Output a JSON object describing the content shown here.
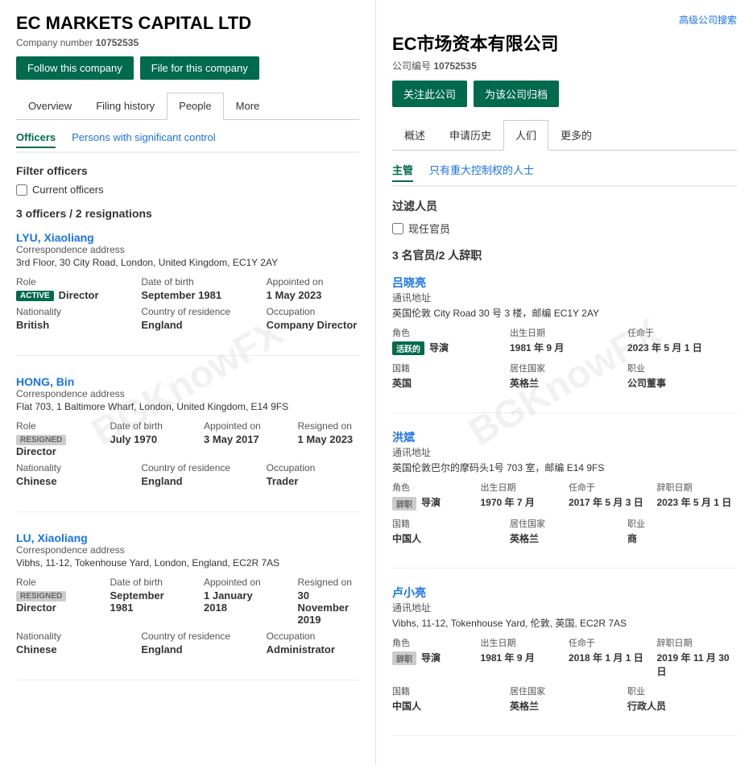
{
  "left": {
    "company_title": "EC MARKETS CAPITAL LTD",
    "company_number_label": "Company number",
    "company_number": "10752535",
    "btn_follow": "Follow this company",
    "btn_file": "File for this company",
    "tabs": [
      {
        "label": "Overview",
        "active": false
      },
      {
        "label": "Filing history",
        "active": false
      },
      {
        "label": "People",
        "active": true
      },
      {
        "label": "More",
        "active": false
      }
    ],
    "sub_tabs": [
      {
        "label": "Officers",
        "active": true
      },
      {
        "label": "Persons with significant control",
        "active": false
      }
    ],
    "filter_title": "Filter officers",
    "current_officers_label": "Current officers",
    "officer_count": "3 officers / 2 resignations",
    "watermark": "BGKnowFX",
    "officers": [
      {
        "name": "LYU, Xiaoliang",
        "address_label": "Correspondence address",
        "address": "3rd Floor, 30 City Road, London, United Kingdom, EC1Y 2AY",
        "role_label": "Role",
        "role": "Director",
        "role_status": "ACTIVE",
        "role_status_type": "active",
        "dob_label": "Date of birth",
        "dob": "September 1981",
        "appointed_label": "Appointed on",
        "appointed": "1 May 2023",
        "nationality_label": "Nationality",
        "nationality": "British",
        "residence_label": "Country of residence",
        "residence": "England",
        "occupation_label": "Occupation",
        "occupation": "Company Director"
      },
      {
        "name": "HONG, Bin",
        "address_label": "Correspondence address",
        "address": "Flat 703, 1 Baltimore Wharf, London, United Kingdom, E14 9FS",
        "role_label": "Role",
        "role": "Director",
        "role_status": "RESIGNED",
        "role_status_type": "resigned",
        "dob_label": "Date of birth",
        "dob": "July 1970",
        "appointed_label": "Appointed on",
        "appointed": "3 May 2017",
        "resigned_label": "Resigned on",
        "resigned": "1 May 2023",
        "nationality_label": "Nationality",
        "nationality": "Chinese",
        "residence_label": "Country of residence",
        "residence": "England",
        "occupation_label": "Occupation",
        "occupation": "Trader"
      },
      {
        "name": "LU, Xiaoliang",
        "address_label": "Correspondence address",
        "address": "Vibhs, 11-12, Tokenhouse Yard, London, England, EC2R 7AS",
        "role_label": "Role",
        "role": "Director",
        "role_status": "RESIGNED",
        "role_status_type": "resigned",
        "dob_label": "Date of birth",
        "dob": "September 1981",
        "appointed_label": "Appointed on",
        "appointed": "1 January 2018",
        "resigned_label": "Resigned on",
        "resigned": "30 November 2019",
        "nationality_label": "Nationality",
        "nationality": "Chinese",
        "residence_label": "Country of residence",
        "residence": "England",
        "occupation_label": "Occupation",
        "occupation": "Administrator"
      }
    ]
  },
  "right": {
    "advanced_search": "高级公司搜索",
    "company_title": "EC市场资本有限公司",
    "company_number_label": "公司编号",
    "company_number": "10752535",
    "btn_follow": "关注此公司",
    "btn_file": "为该公司归档",
    "tabs": [
      {
        "label": "概述",
        "active": false
      },
      {
        "label": "申请历史",
        "active": false
      },
      {
        "label": "人们",
        "active": true
      },
      {
        "label": "更多的",
        "active": false
      }
    ],
    "sub_tabs": [
      {
        "label": "主管",
        "active": true
      },
      {
        "label": "只有重大控制权的人士",
        "active": false
      }
    ],
    "filter_title": "过滤人员",
    "current_officers_label": "现任官员",
    "officer_count": "3 名官员/2 人辞职",
    "watermark": "BGKnowFX",
    "officers": [
      {
        "name": "吕晓亮",
        "address_label": "通讯地址",
        "address": "英国伦敦 City Road 30 号 3 楼，邮编 EC1Y 2AY",
        "role_label": "角色",
        "role": "导演",
        "role_status": "活跃的",
        "role_status_type": "active",
        "dob_label": "出生日期",
        "dob": "1981 年 9 月",
        "appointed_label": "任命于",
        "appointed": "2023 年 5 月 1 日",
        "nationality_label": "国籍",
        "nationality": "英国",
        "residence_label": "居住国家",
        "residence": "英格兰",
        "occupation_label": "职业",
        "occupation": "公司董事"
      },
      {
        "name": "洪斌",
        "address_label": "通讯地址",
        "address": "英国伦敦巴尔的摩码头1号 703 室，邮编 E14 9FS",
        "role_label": "角色",
        "role": "导演",
        "role_status": "辞职",
        "role_status_type": "resigned",
        "dob_label": "出生日期",
        "dob": "1970 年 7 月",
        "appointed_label": "任命于",
        "appointed": "2017 年 5 月 3 日",
        "resigned_label": "辞职日期",
        "resigned": "2023 年 5 月 1 日",
        "nationality_label": "国籍",
        "nationality": "中国人",
        "residence_label": "居住国家",
        "residence": "英格兰",
        "occupation_label": "职业",
        "occupation": "商"
      },
      {
        "name": "卢小亮",
        "address_label": "通讯地址",
        "address": "Vibhs, 11-12, Tokenhouse Yard, 伦敦, 英国, EC2R 7AS",
        "role_label": "角色",
        "role": "导演",
        "role_status": "辞职",
        "role_status_type": "resigned",
        "dob_label": "出生日期",
        "dob": "1981 年 9 月",
        "appointed_label": "任命于",
        "appointed": "2018 年 1 月 1 日",
        "resigned_label": "辞职日期",
        "resigned": "2019 年 11 月 30 日",
        "nationality_label": "国籍",
        "nationality": "中国人",
        "residence_label": "居住国家",
        "residence": "英格兰",
        "occupation_label": "职业",
        "occupation": "行政人员"
      }
    ]
  }
}
